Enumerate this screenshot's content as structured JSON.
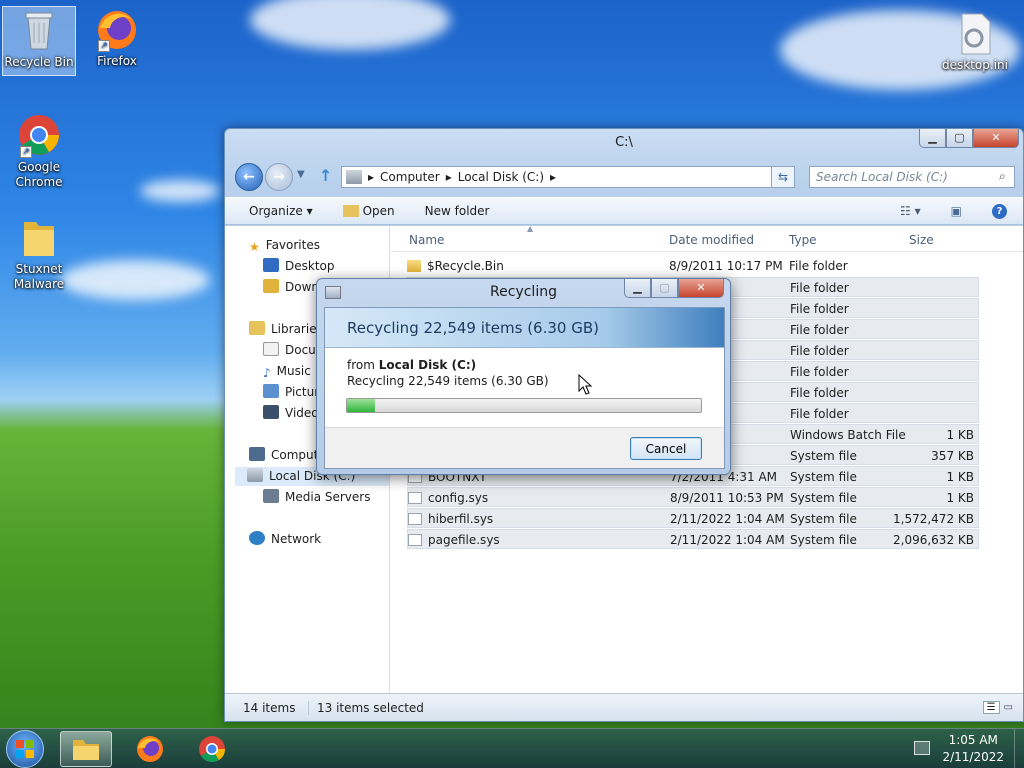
{
  "desktop": {
    "icons": [
      {
        "label": "Recycle Bin"
      },
      {
        "label": "Firefox"
      },
      {
        "label": "Google Chrome"
      },
      {
        "label": "Stuxnet Malware"
      },
      {
        "label": "desktop.ini"
      }
    ]
  },
  "explorer": {
    "title": "C:\\",
    "address": [
      "Computer",
      "Local Disk (C:)"
    ],
    "search_placeholder": "Search Local Disk (C:)",
    "toolbar": {
      "organize": "Organize",
      "open": "Open",
      "new_folder": "New folder"
    },
    "nav": {
      "favorites": "Favorites",
      "desktop": "Desktop",
      "downloads": "Downl",
      "libraries": "Libraries",
      "documents": "Docu",
      "music": "Music",
      "pictures": "Pictur",
      "videos": "Video",
      "computer": "Comput",
      "local_disk": "Local Disk (C:)",
      "media_servers": "Media Servers",
      "network": "Network"
    },
    "columns": {
      "name": "Name",
      "date": "Date modified",
      "type": "Type",
      "size": "Size"
    },
    "rows": [
      {
        "name": "$Recycle.Bin",
        "date": "8/9/2011 10:17 PM",
        "type": "File folder",
        "size": ""
      },
      {
        "name": "",
        "date": "09 PM",
        "type": "File folder",
        "size": ""
      },
      {
        "name": "",
        "date": "17 PM",
        "type": "File folder",
        "size": ""
      },
      {
        "name": "",
        "date": "11:46 ...",
        "type": "File folder",
        "size": ""
      },
      {
        "name": "",
        "date": "11:31 ...",
        "type": "File folder",
        "size": ""
      },
      {
        "name": "",
        "date": "5:40 AM",
        "type": "File folder",
        "size": ""
      },
      {
        "name": "",
        "date": "10:47 ...",
        "type": "File folder",
        "size": ""
      },
      {
        "name": "",
        "date": "11:43 ...",
        "type": "File folder",
        "size": ""
      },
      {
        "name": "",
        "date": "53 PM",
        "type": "Windows Batch File",
        "size": "1 KB"
      },
      {
        "name": "",
        "date": "50 AM",
        "type": "System file",
        "size": "357 KB"
      },
      {
        "name": "BOOTNXT",
        "date": "7/2/2011 4:31 AM",
        "type": "System file",
        "size": "1 KB"
      },
      {
        "name": "config.sys",
        "date": "8/9/2011 10:53 PM",
        "type": "System file",
        "size": "1 KB"
      },
      {
        "name": "hiberfil.sys",
        "date": "2/11/2022 1:04 AM",
        "type": "System file",
        "size": "1,572,472 KB"
      },
      {
        "name": "pagefile.sys",
        "date": "2/11/2022 1:04 AM",
        "type": "System file",
        "size": "2,096,632 KB"
      }
    ],
    "status": {
      "count": "14 items",
      "selected": "13 items selected"
    }
  },
  "dialog": {
    "title": "Recycling",
    "heading": "Recycling 22,549 items (6.30 GB)",
    "from_label": "from",
    "from_value": "Local Disk (C:)",
    "detail": "Recycling 22,549 items (6.30 GB)",
    "progress": 0.08,
    "cancel": "Cancel"
  },
  "taskbar": {
    "time": "1:05 AM",
    "date": "2/11/2022"
  },
  "colors": {
    "accent": "#1c63c9",
    "progress": "#2eb43a"
  }
}
